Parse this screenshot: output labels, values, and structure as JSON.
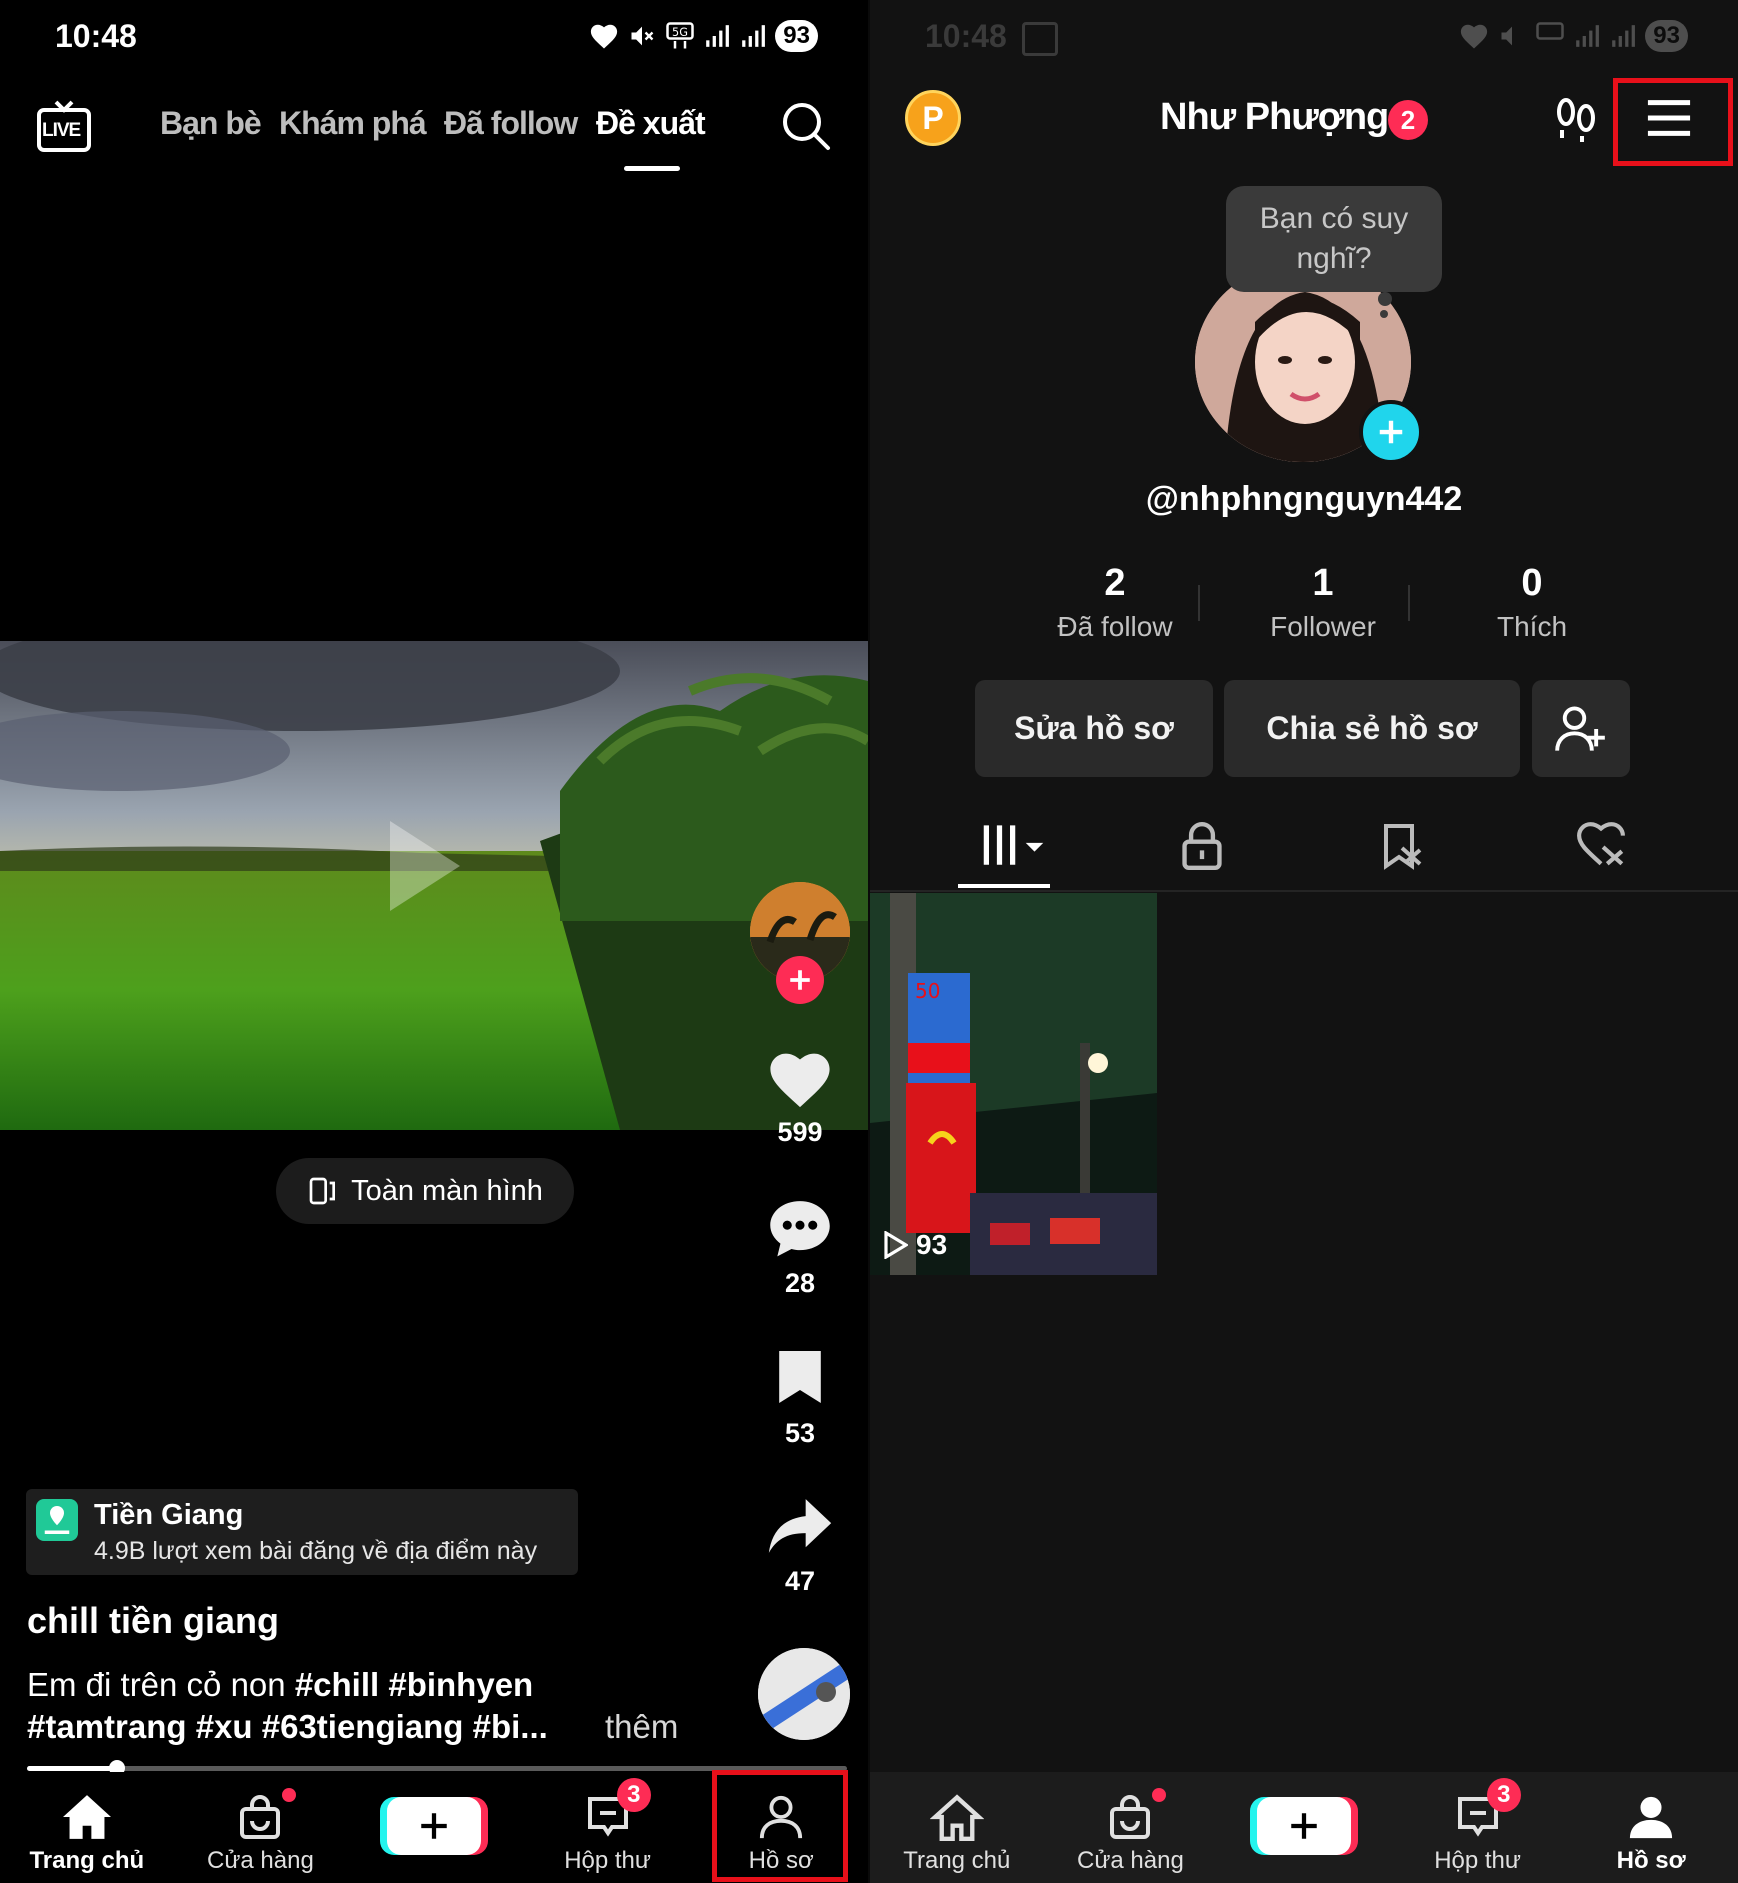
{
  "left": {
    "status": {
      "time": "10:48",
      "battery": "93"
    },
    "top_tabs": [
      "Bạn bè",
      "Khám phá",
      "Đã follow",
      "Đề xuất"
    ],
    "live_label": "LIVE",
    "fullscreen_label": "Toàn màn hình",
    "actions": {
      "likes": "599",
      "comments": "28",
      "saves": "53",
      "shares": "47"
    },
    "location": {
      "name": "Tiền Giang",
      "views": "4.9B lượt xem bài đăng về địa điểm này"
    },
    "video": {
      "title": "chill tiền giang",
      "caption_line1_plain": "Em đi trên cỏ non ",
      "caption_line1_tags": "#chill #binhyen",
      "caption_line2": "#tamtrang #xu #63tiengiang #bi...",
      "more": "thêm",
      "progress": 0.11
    },
    "bottom_nav": {
      "home": "Trang chủ",
      "shop": "Cửa hàng",
      "inbox": "Hộp thư",
      "inbox_badge": "3",
      "profile": "Hồ sơ"
    }
  },
  "right": {
    "status": {
      "time": "10:48",
      "battery": "93"
    },
    "coin_label": "P",
    "profile_name": "Như Phượng",
    "name_badge": "2",
    "note_bubble": "Bạn có suy nghĩ?",
    "username": "@nhphngnguyn442",
    "stats": [
      {
        "value": "2",
        "label": "Đã follow"
      },
      {
        "value": "1",
        "label": "Follower"
      },
      {
        "value": "0",
        "label": "Thích"
      }
    ],
    "buttons": {
      "edit": "Sửa hồ sơ",
      "share": "Chia sẻ hồ sơ"
    },
    "video_views": "93",
    "bottom_nav": {
      "home": "Trang chủ",
      "shop": "Cửa hàng",
      "inbox": "Hộp thư",
      "inbox_badge": "3",
      "profile": "Hồ sơ"
    }
  },
  "colors": {
    "accent_red": "#fe2c55",
    "highlight_box": "#e8101a",
    "teal": "#25f4ee"
  }
}
